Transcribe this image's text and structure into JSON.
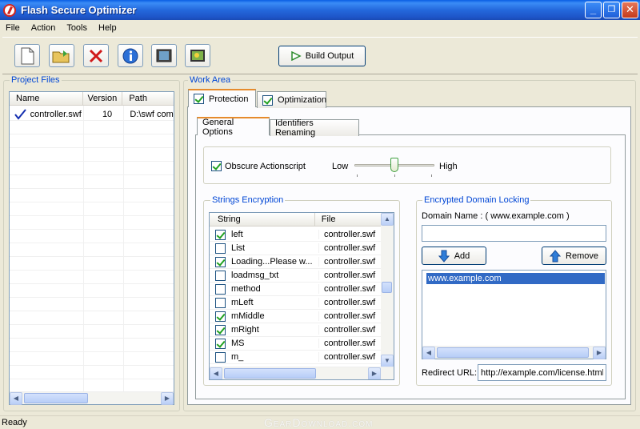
{
  "window": {
    "title": "Flash Secure Optimizer",
    "minimize": "_",
    "maximize": "❐",
    "close": "✕"
  },
  "menu": [
    "File",
    "Action",
    "Tools",
    "Help"
  ],
  "toolbar": {
    "icons": [
      "new-file-icon",
      "open-folder-icon",
      "delete-icon",
      "info-icon",
      "preview-icon",
      "settings-monitor-icon"
    ],
    "build_label": "Build Output"
  },
  "project_files": {
    "label": "Project Files",
    "columns": [
      "Name",
      "Version",
      "Path"
    ],
    "rows": [
      {
        "name": "controller.swf",
        "version": "10",
        "path": "D:\\swf comp"
      }
    ]
  },
  "work_area": {
    "label": "Work Area",
    "tabs": [
      "Protection",
      "Optimization"
    ],
    "subtabs": [
      "General Options",
      "Identifiers Renaming"
    ],
    "obscure_label": "Obscure Actionscript",
    "slider_low": "Low",
    "slider_high": "High",
    "slider_level": 0.5,
    "strings_encryption": {
      "label": "Strings Encryption",
      "columns": [
        "String",
        "File"
      ],
      "rows": [
        {
          "string": "left",
          "file": "controller.swf",
          "checked": true
        },
        {
          "string": "List",
          "file": "controller.swf",
          "checked": false
        },
        {
          "string": "Loading...Please w...",
          "file": "controller.swf",
          "checked": true
        },
        {
          "string": "loadmsg_txt",
          "file": "controller.swf",
          "checked": false
        },
        {
          "string": "method",
          "file": "controller.swf",
          "checked": false
        },
        {
          "string": "mLeft",
          "file": "controller.swf",
          "checked": false
        },
        {
          "string": "mMiddle",
          "file": "controller.swf",
          "checked": true
        },
        {
          "string": "mRight",
          "file": "controller.swf",
          "checked": true
        },
        {
          "string": "MS",
          "file": "controller.swf",
          "checked": true
        },
        {
          "string": "m_",
          "file": "controller.swf",
          "checked": false
        }
      ]
    },
    "domain_locking": {
      "label": "Encrypted Domain Locking",
      "domain_name_label": "Domain Name :  ( www.example.com )",
      "domain_input": "",
      "add_label": "Add",
      "remove_label": "Remove",
      "domains": [
        "www.example.com"
      ],
      "redirect_label": "Redirect URL:",
      "redirect_value": "http://example.com/license.html"
    }
  },
  "status": "Ready",
  "watermark": "GearDownload.com"
}
